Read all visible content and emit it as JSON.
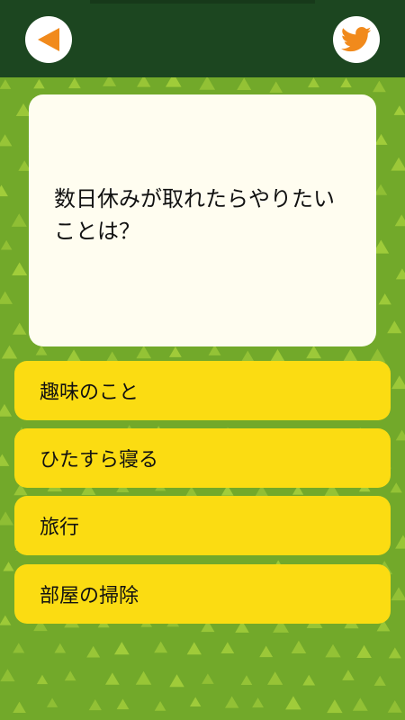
{
  "colors": {
    "header_bg": "#1c4620",
    "background": "#72a92a",
    "pattern_triangle": "#a6d03c",
    "card_bg": "#fffdf0",
    "answer_bg": "#fbdc12",
    "icon_orange": "#f18a1c"
  },
  "header": {
    "back_icon": "back-arrow-icon",
    "share_icon": "twitter-bird-icon"
  },
  "question": {
    "line1": "数日休みが取れたらやりたい",
    "line2": "ことは？"
  },
  "answers": [
    {
      "label": "趣味のこと"
    },
    {
      "label": "ひたすら寝る"
    },
    {
      "label": "旅行"
    },
    {
      "label": "部屋の掃除"
    }
  ]
}
